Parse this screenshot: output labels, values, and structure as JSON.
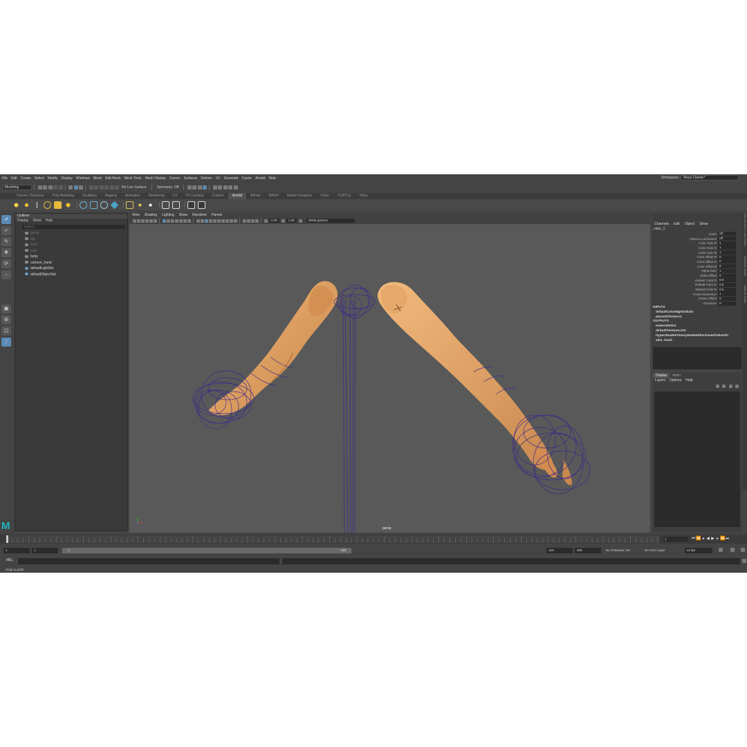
{
  "menubar": [
    "File",
    "Edit",
    "Create",
    "Select",
    "Modify",
    "Display",
    "Windows",
    "Mesh",
    "Edit Mesh",
    "Mesh Tools",
    "Mesh Display",
    "Curves",
    "Surfaces",
    "Deform",
    "UV",
    "Generate",
    "Cache",
    "Arnold",
    "Help"
  ],
  "workspace": {
    "label": "Workspace :",
    "value": "Maya Classic*"
  },
  "statusline": {
    "mode": "Modeling",
    "live_surface": "No Live Surface",
    "symmetry": "Symmetry: Off"
  },
  "shelf_tabs": [
    "Curves / Surfaces",
    "Poly Modeling",
    "Sculpting",
    "Rigging",
    "Animation",
    "Rendering",
    "FX",
    "FX Caching",
    "Custom",
    "Arnold",
    "Bifrost",
    "MASH",
    "Motion Graphics",
    "XGen",
    "TURTLE",
    "VRay"
  ],
  "shelf_active": "Arnold",
  "outliner": {
    "title": "Outliner",
    "menu": [
      "Display",
      "Show",
      "Help"
    ],
    "search_placeholder": "Search...",
    "items": [
      {
        "label": "persp",
        "dim": true,
        "icon": "camera-icon"
      },
      {
        "label": "top",
        "dim": true,
        "icon": "camera-icon"
      },
      {
        "label": "front",
        "dim": true,
        "icon": "camera-icon"
      },
      {
        "label": "side",
        "dim": true,
        "icon": "camera-icon"
      },
      {
        "label": "body",
        "dim": false,
        "icon": "mesh-icon"
      },
      {
        "label": "cartoon_hand",
        "dim": false,
        "icon": "joint-icon"
      },
      {
        "label": "defaultLightSet",
        "dim": false,
        "icon": "set-icon"
      },
      {
        "label": "defaultObjectSet",
        "dim": false,
        "icon": "set-icon"
      }
    ]
  },
  "viewport": {
    "menu": [
      "View",
      "Shading",
      "Lighting",
      "Show",
      "Renderer",
      "Panels"
    ],
    "exposure": "0.00",
    "gamma": "1.00",
    "colorspace": "sRGB gamma",
    "camera_label": "persp"
  },
  "channelbox": {
    "menu": [
      "Channels",
      "Edit",
      "Object",
      "Show"
    ],
    "node": "color_1",
    "attrs": [
      {
        "label": "Invert",
        "value": "off"
      },
      {
        "label": "Alpha Is Luminance",
        "value": "off"
      },
      {
        "label": "Color Gain R",
        "value": "1"
      },
      {
        "label": "Color Gain G",
        "value": "1"
      },
      {
        "label": "Color Gain B",
        "value": "1"
      },
      {
        "label": "Color Offset R",
        "value": "0"
      },
      {
        "label": "Color Offset G",
        "value": "0"
      },
      {
        "label": "Color Offset B",
        "value": "0"
      },
      {
        "label": "Alpha Gain",
        "value": "1"
      },
      {
        "label": "Alpha Offset",
        "value": "0"
      },
      {
        "label": "Default Color R",
        "value": "0.5"
      },
      {
        "label": "Default Color G",
        "value": "0.5"
      },
      {
        "label": "Default Color B",
        "value": "0.5"
      },
      {
        "label": "Frame Extension",
        "value": "1"
      },
      {
        "label": "Frame Offset",
        "value": "0"
      },
      {
        "label": "Exposure",
        "value": "0"
      }
    ],
    "inputs_label": "INPUTS",
    "inputs": [
      "defaultColorMgtGlobals",
      "place2dTexture1"
    ],
    "outputs_label": "OUTPUTS",
    "outputs": [
      "materialInfo1",
      "defaultTextureList1",
      "hyperShadePrimaryNodeEditorSavedTabsInfo",
      "skin_hand"
    ]
  },
  "layers": {
    "tabs": [
      "Display",
      "Anim"
    ],
    "menu": [
      "Layers",
      "Options",
      "Help"
    ]
  },
  "side_tabs": [
    "Channel Box / Layer Editor",
    "Modeling Toolkit",
    "Attribute Editor"
  ],
  "timeline": {
    "current": "1",
    "playback_start": "1",
    "range_start": "1",
    "range_end": "120",
    "end": "120",
    "anim_end": "200",
    "character_set": "No Character Set",
    "anim_layer": "No Anim Layer",
    "fps": "24 fps"
  },
  "cmdline": {
    "label": "MEL"
  },
  "help_line": "Snap to grids"
}
